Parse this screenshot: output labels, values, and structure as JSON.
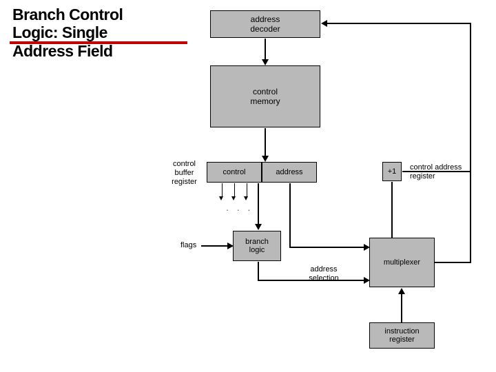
{
  "title_line1": "Branch Control",
  "title_line2": "Logic: Single",
  "title_line3": "Address Field",
  "blocks": {
    "address_decoder": "address\ndecoder",
    "control_memory": "control\nmemory",
    "control": "control",
    "address": "address",
    "plus_one": "+1",
    "branch_logic": "branch\nlogic",
    "multiplexer": "multiplexer",
    "instruction_register": "instruction\nregister"
  },
  "labels": {
    "control_buffer_register": "control\nbuffer\nregister",
    "control_address_register": "control address\nregister",
    "flags": "flags",
    "address_selection": "address\nselection"
  },
  "dots": ". . ."
}
